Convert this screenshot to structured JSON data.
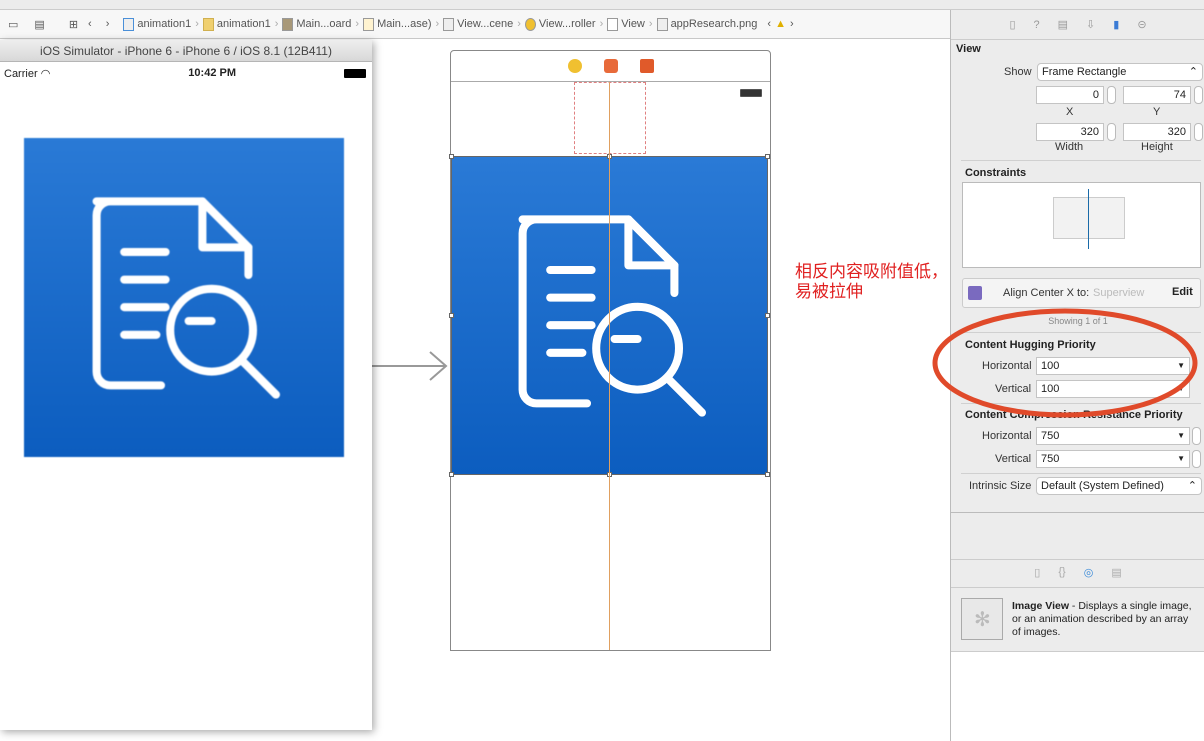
{
  "breadcrumb": [
    "animation1",
    "animation1",
    "Main...oard",
    "Main...ase)",
    "View...cene",
    "View...roller",
    "View",
    "appResearch.png"
  ],
  "simulator": {
    "title": "iOS Simulator - iPhone 6 - iPhone 6 / iOS 8.1 (12B411)",
    "carrier": "Carrier",
    "time": "10:42 PM"
  },
  "annotation": {
    "line1": "相反内容吸附值低，",
    "line2": "易被拉伸",
    "color": "#e02020"
  },
  "inspector": {
    "section": "View",
    "show_label": "Show",
    "show_value": "Frame Rectangle",
    "x": "0",
    "y": "74",
    "width": "320",
    "height": "320",
    "x_label": "X",
    "y_label": "Y",
    "width_label": "Width",
    "height_label": "Height",
    "constraints_title": "Constraints",
    "constraint": {
      "label": "Align Center X to:",
      "target": "Superview",
      "edit": "Edit"
    },
    "showing": "Showing 1 of 1",
    "hugging": {
      "title": "Content Hugging Priority",
      "h_label": "Horizontal",
      "h_value": "100",
      "v_label": "Vertical",
      "v_value": "100"
    },
    "compression": {
      "title": "Content Compression Resistance Priority",
      "h_label": "Horizontal",
      "h_value": "750",
      "v_label": "Vertical",
      "v_value": "750"
    },
    "intrinsic_label": "Intrinsic Size",
    "intrinsic_value": "Default (System Defined)",
    "library": {
      "name": "Image View",
      "desc": " - Displays a single image, or an animation described by an array of images."
    }
  },
  "colors": {
    "accent": "#1467c8",
    "guide": "#e0a060",
    "highlight": "#e04a2a"
  }
}
